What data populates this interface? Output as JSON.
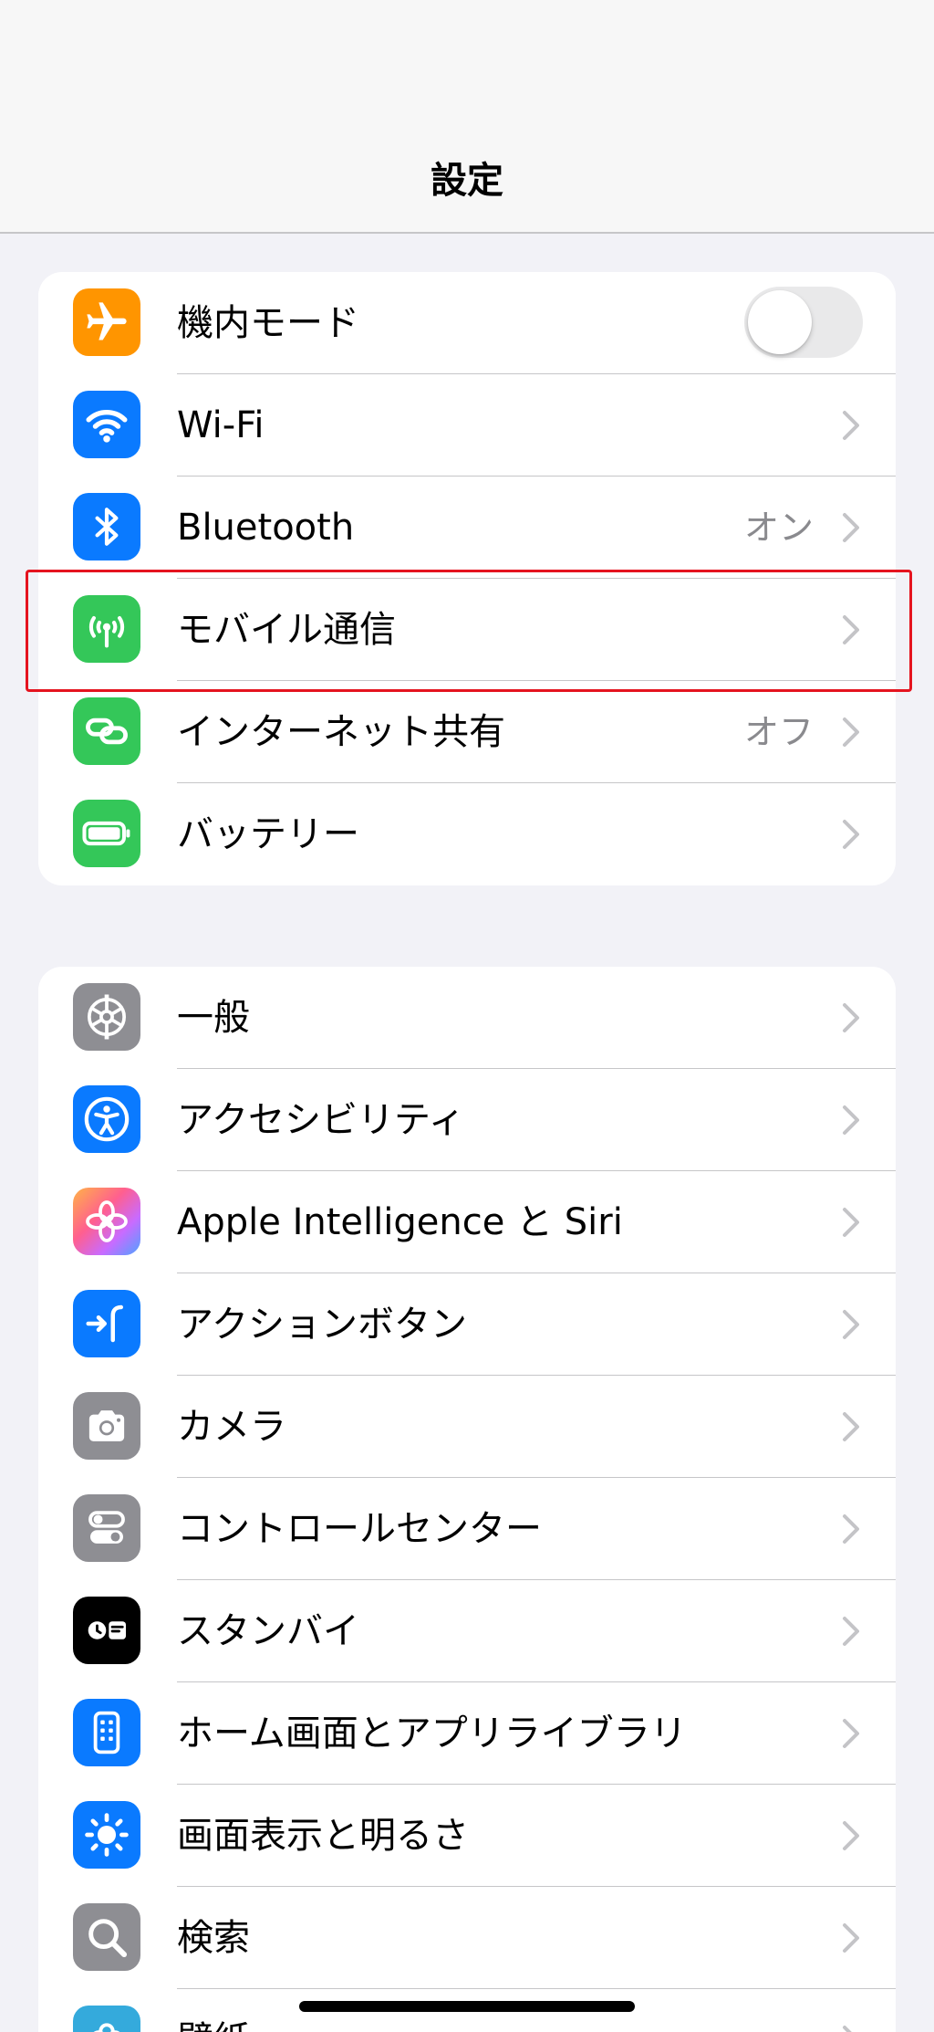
{
  "nav": {
    "title": "設定"
  },
  "groups": [
    {
      "rows": [
        {
          "label": "機内モード",
          "icon": "airplane-icon",
          "color": "#ff9500",
          "control": "toggle",
          "toggle_on": false
        },
        {
          "label": "Wi-Fi",
          "icon": "wifi-icon",
          "color": "#0a7aff",
          "control": "chevron"
        },
        {
          "label": "Bluetooth",
          "icon": "bluetooth-icon",
          "color": "#0a7aff",
          "value": "オン",
          "control": "chevron"
        },
        {
          "label": "モバイル通信",
          "icon": "antenna-icon",
          "color": "#34c759",
          "control": "chevron"
        },
        {
          "label": "インターネット共有",
          "icon": "link-icon",
          "color": "#34c759",
          "value": "オフ",
          "control": "chevron"
        },
        {
          "label": "バッテリー",
          "icon": "battery-icon",
          "color": "#34c759",
          "control": "chevron"
        }
      ]
    },
    {
      "rows": [
        {
          "label": "一般",
          "icon": "gear-icon",
          "color": "#8e8e93",
          "control": "chevron"
        },
        {
          "label": "アクセシビリティ",
          "icon": "accessibility-icon",
          "color": "#0a7aff",
          "control": "chevron"
        },
        {
          "label": "Apple Intelligence と Siri",
          "icon": "apple-intelligence-icon",
          "color": "#ff6b9a",
          "control": "chevron"
        },
        {
          "label": "アクションボタン",
          "icon": "action-button-icon",
          "color": "#0a7aff",
          "control": "chevron"
        },
        {
          "label": "カメラ",
          "icon": "camera-icon",
          "color": "#8e8e93",
          "control": "chevron"
        },
        {
          "label": "コントロールセンター",
          "icon": "switches-icon",
          "color": "#8e8e93",
          "control": "chevron"
        },
        {
          "label": "スタンバイ",
          "icon": "standby-icon",
          "color": "#000000",
          "control": "chevron"
        },
        {
          "label": "ホーム画面とアプリライブラリ",
          "icon": "home-screen-icon",
          "color": "#0a7aff",
          "control": "chevron"
        },
        {
          "label": "画面表示と明るさ",
          "icon": "brightness-icon",
          "color": "#0a7aff",
          "control": "chevron"
        },
        {
          "label": "検索",
          "icon": "search-icon",
          "color": "#8e8e93",
          "control": "chevron"
        },
        {
          "label": "壁紙",
          "icon": "wallpaper-icon",
          "color": "#34aadc",
          "control": "chevron"
        }
      ]
    }
  ],
  "highlight": {
    "target": "モバイル通信",
    "color": "#e5141f"
  }
}
